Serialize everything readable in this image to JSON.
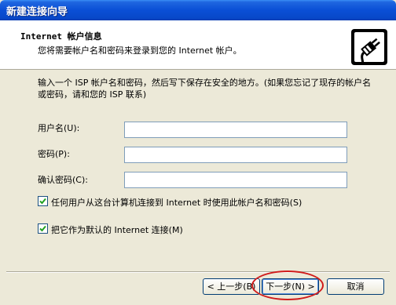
{
  "window": {
    "title": "新建连接向导"
  },
  "header": {
    "title": "Internet 帐户信息",
    "subtitle": "您将需要帐户名和密码来登录到您的 Internet 帐户。"
  },
  "main": {
    "description": "输入一个 ISP 帐户名和密码，然后写下保存在安全的地方。(如果您忘记了现存的帐户名或密码，请和您的 ISP 联系)",
    "fields": [
      {
        "label": "用户名(U):",
        "value": ""
      },
      {
        "label": "密码(P):",
        "value": ""
      },
      {
        "label": "确认密码(C):",
        "value": ""
      }
    ],
    "checkboxes": [
      {
        "label": "任何用户从这台计算机连接到 Internet 时使用此帐户名和密码(S)",
        "checked": true
      },
      {
        "label": "把它作为默认的 Internet 连接(M)",
        "checked": true
      }
    ]
  },
  "buttons": {
    "back": "< 上一步(B)",
    "next": "下一步(N) >",
    "cancel": "取消"
  },
  "colors": {
    "titlebar": "#0a4fd6",
    "highlight": "#d01b1b"
  }
}
